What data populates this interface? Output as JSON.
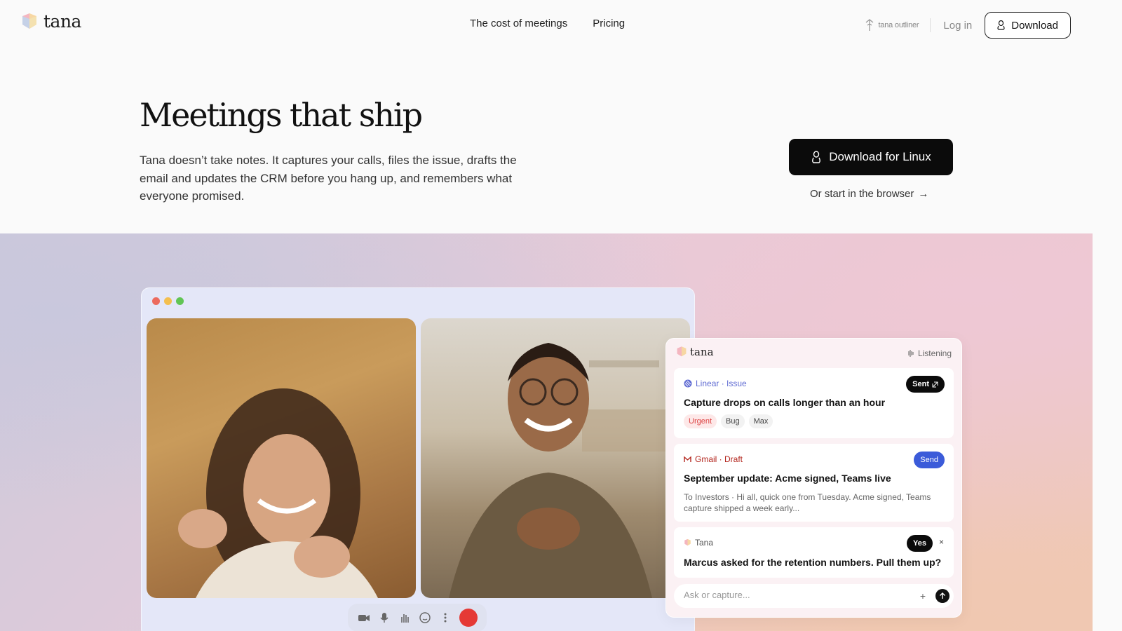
{
  "nav": {
    "logo_text": "tana",
    "links": [
      "The cost of meetings",
      "Pricing"
    ],
    "outliner_label": "tana outliner",
    "login_label": "Log in",
    "download_label": "Download"
  },
  "hero": {
    "title": "Meetings that ship",
    "subtitle": "Tana doesn’t take notes. It captures your calls, files the issue, drafts the email and updates the CRM before you hang up, and remembers what everyone promised.",
    "cta_primary": "Download for Linux",
    "cta_secondary": "Or start in the browser"
  },
  "call": {
    "window_dots": [
      "#ec6a5e",
      "#f4bf4f",
      "#61c554"
    ]
  },
  "panel": {
    "logo_text": "tana",
    "status": "Listening",
    "cards": [
      {
        "source": "Linear · Issue",
        "action": "Sent",
        "title": "Capture drops on calls longer than an hour",
        "tags": [
          "Urgent",
          "Bug",
          "Max"
        ]
      },
      {
        "source": "Gmail · Draft",
        "action": "Send",
        "title": "September update: Acme signed, Teams live",
        "preview": "To Investors · Hi all, quick one from Tuesday. Acme signed, Teams capture shipped a week early..."
      },
      {
        "source": "Tana",
        "action": "Yes",
        "close": "×",
        "title": "Marcus asked for the retention numbers. Pull them up?"
      }
    ],
    "input_placeholder": "Ask or capture...",
    "plus_label": "+"
  },
  "colors": {
    "primary": "#0b0b0b",
    "linear_accent": "#5e6ad2",
    "gmail_accent": "#b3261e",
    "send_button": "#3b5bd9",
    "hangup": "#e53935"
  }
}
